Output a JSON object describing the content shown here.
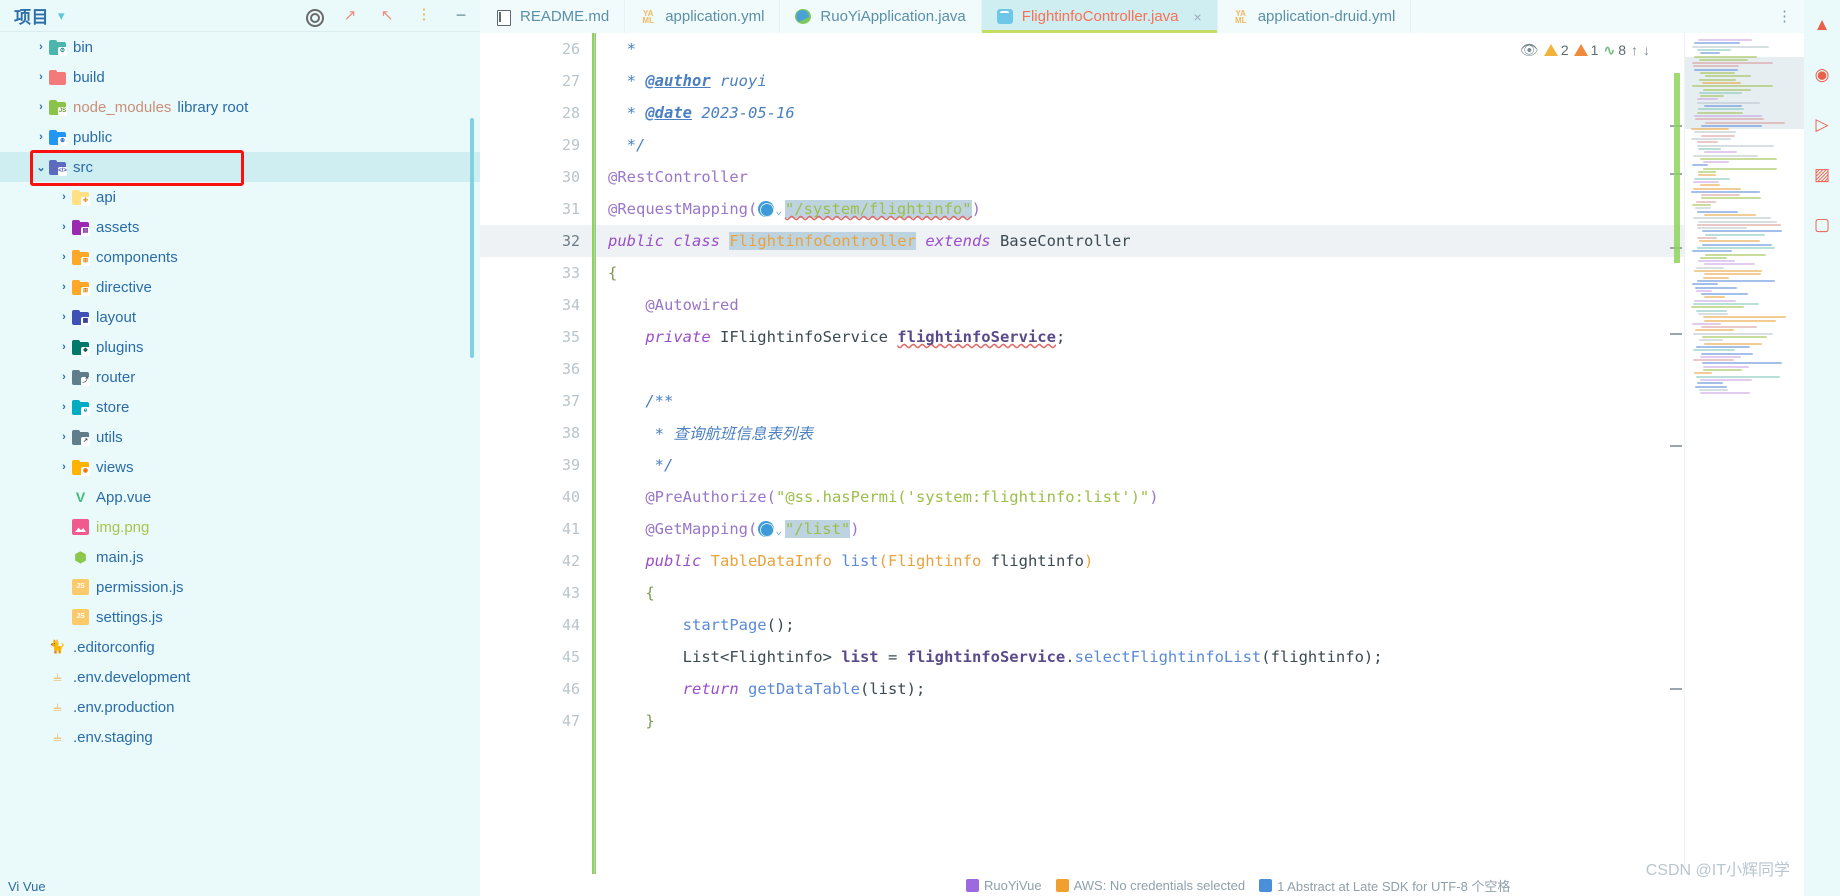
{
  "project_panel": {
    "title": "项目",
    "header_icons": [
      "target-icon",
      "expand-icon",
      "collapse-icon",
      "more-options-icon",
      "minimize-icon"
    ],
    "tree": [
      {
        "name": "bin",
        "type": "folder",
        "indent": 1,
        "arrow": "›",
        "color": "#4db6ac",
        "badge": "⚙",
        "badge_color": "#2a8f86",
        "selected": false
      },
      {
        "name": "build",
        "type": "folder",
        "indent": 1,
        "arrow": "›",
        "color": "#f27a7a",
        "badge": "",
        "badge_color": "#c44",
        "selected": false
      },
      {
        "name": "node_modules",
        "type": "folder",
        "indent": 1,
        "arrow": "›",
        "color": "#8bc34a",
        "badge": "JS",
        "badge_color": "#6a9a2a",
        "selected": false,
        "suffix": "library root"
      },
      {
        "name": "public",
        "type": "folder",
        "indent": 1,
        "arrow": "›",
        "color": "#2196f3",
        "badge": "⊕",
        "badge_color": "#1565c0",
        "selected": false
      },
      {
        "name": "src",
        "type": "folder",
        "indent": 1,
        "arrow": "⌄",
        "color": "#5c6bc0",
        "badge": "</>",
        "badge_color": "#3949ab",
        "selected": true
      },
      {
        "name": "api",
        "type": "folder",
        "indent": 2,
        "arrow": "›",
        "color": "#ffe082",
        "badge": "✤",
        "badge_color": "#e8933a",
        "selected": false
      },
      {
        "name": "assets",
        "type": "folder",
        "indent": 2,
        "arrow": "›",
        "color": "#9c27b0",
        "badge": "▤",
        "badge_color": "#7b1fa2",
        "selected": false
      },
      {
        "name": "components",
        "type": "folder",
        "indent": 2,
        "arrow": "›",
        "color": "#ffa726",
        "badge": "⊞",
        "badge_color": "#e07a00",
        "selected": false
      },
      {
        "name": "directive",
        "type": "folder",
        "indent": 2,
        "arrow": "›",
        "color": "#ffa726",
        "badge": "⊞",
        "badge_color": "#e07a00",
        "selected": false
      },
      {
        "name": "layout",
        "type": "folder",
        "indent": 2,
        "arrow": "›",
        "color": "#3f51b5",
        "badge": "▦",
        "badge_color": "#283593",
        "selected": false
      },
      {
        "name": "plugins",
        "type": "folder",
        "indent": 2,
        "arrow": "›",
        "color": "#00796b",
        "badge": "❖",
        "badge_color": "#004d40",
        "selected": false
      },
      {
        "name": "router",
        "type": "folder",
        "indent": 2,
        "arrow": "›",
        "color": "#607d8b",
        "badge": "⤴",
        "badge_color": "#37474f",
        "selected": false
      },
      {
        "name": "store",
        "type": "folder",
        "indent": 2,
        "arrow": "›",
        "color": "#00acc1",
        "badge": "e",
        "badge_color": "#00838f",
        "selected": false
      },
      {
        "name": "utils",
        "type": "folder",
        "indent": 2,
        "arrow": "›",
        "color": "#607d8b",
        "badge": "↗",
        "badge_color": "#37474f",
        "selected": false
      },
      {
        "name": "views",
        "type": "folder",
        "indent": 2,
        "arrow": "›",
        "color": "#ffb300",
        "badge": "◉",
        "badge_color": "#ef6c00",
        "selected": false
      },
      {
        "name": "App.vue",
        "type": "vue",
        "indent": 2,
        "arrow": "",
        "selected": false
      },
      {
        "name": "img.png",
        "type": "png",
        "indent": 2,
        "arrow": "",
        "selected": false,
        "dim": "green"
      },
      {
        "name": "main.js",
        "type": "node",
        "indent": 2,
        "arrow": "",
        "selected": false
      },
      {
        "name": "permission.js",
        "type": "js",
        "indent": 2,
        "arrow": "",
        "selected": false
      },
      {
        "name": "settings.js",
        "type": "js",
        "indent": 2,
        "arrow": "",
        "selected": false
      },
      {
        "name": ".editorconfig",
        "type": "cat",
        "indent": 1,
        "arrow": "",
        "selected": false
      },
      {
        "name": ".env.development",
        "type": "env",
        "indent": 1,
        "arrow": "",
        "selected": false
      },
      {
        "name": ".env.production",
        "type": "env",
        "indent": 1,
        "arrow": "",
        "selected": false
      },
      {
        "name": ".env.staging",
        "type": "env",
        "indent": 1,
        "arrow": "",
        "selected": false
      }
    ]
  },
  "tabs": [
    {
      "label": "README.md",
      "icon": "markdown-icon",
      "active": false,
      "closable": false
    },
    {
      "label": "application.yml",
      "icon": "yaml-icon",
      "active": false,
      "closable": false
    },
    {
      "label": "RuoYiApplication.java",
      "icon": "spring-icon",
      "active": false,
      "closable": false
    },
    {
      "label": "FlightinfoController.java",
      "icon": "java-class-icon",
      "active": true,
      "closable": true
    },
    {
      "label": "application-druid.yml",
      "icon": "yaml-icon",
      "active": false,
      "closable": false
    }
  ],
  "tab_close_label": "×",
  "inspection": {
    "eye_icon": "inspection-eye-icon",
    "warnings": "2",
    "weak_warnings": "1",
    "typos": "8",
    "prev_icon": "↑",
    "next_icon": "↓"
  },
  "editor": {
    "active_file": "FlightinfoController.java",
    "current_line": 32,
    "lines": [
      {
        "n": 26,
        "marker": "",
        "tokens": [
          {
            "t": "*",
            "c": "cmt",
            "indent": 0
          }
        ]
      },
      {
        "n": 27,
        "marker": "",
        "tokens": [
          {
            "t": "* @author ruoyi",
            "c": "cmt",
            "indent": 0
          }
        ]
      },
      {
        "n": 28,
        "marker": "",
        "tokens": [
          {
            "t": "* @date 2023-05-16",
            "c": "cmt",
            "indent": 0
          }
        ]
      },
      {
        "n": 29,
        "marker": "",
        "tokens": [
          {
            "t": "*/",
            "c": "cmt",
            "indent": 0
          }
        ]
      },
      {
        "n": 30,
        "marker": "",
        "tokens": [
          {
            "t": "@RestController",
            "c": "ann",
            "indent": 0
          }
        ]
      },
      {
        "n": 31,
        "marker": "",
        "tokens": [
          {
            "t": "@RequestMapping(",
            "c": "ann",
            "indent": 0
          }
        ]
      },
      {
        "n": 32,
        "marker": "bookmark",
        "tokens": [
          {
            "t": "public class FlightinfoController extends BaseController",
            "c": "mix",
            "indent": 0
          }
        ]
      },
      {
        "n": 33,
        "marker": "",
        "tokens": [
          {
            "t": "{",
            "c": "brc",
            "indent": 0
          }
        ]
      },
      {
        "n": 34,
        "marker": "",
        "tokens": [
          {
            "t": "@Autowired",
            "c": "ann",
            "indent": 1
          }
        ]
      },
      {
        "n": 35,
        "marker": "bean",
        "tokens": [
          {
            "t": "private IFlightinfoService flightinfoService;",
            "c": "mix",
            "indent": 1
          }
        ]
      },
      {
        "n": 36,
        "marker": "",
        "tokens": [
          {
            "t": "",
            "c": "pln",
            "indent": 0
          }
        ]
      },
      {
        "n": 37,
        "marker": "",
        "tokens": [
          {
            "t": "/**",
            "c": "cmt",
            "indent": 1
          }
        ]
      },
      {
        "n": 38,
        "marker": "",
        "tokens": [
          {
            "t": "* 查询航班信息表列表",
            "c": "cmt",
            "indent": 1
          }
        ]
      },
      {
        "n": 39,
        "marker": "",
        "tokens": [
          {
            "t": "*/",
            "c": "cmt",
            "indent": 1
          }
        ]
      },
      {
        "n": 40,
        "marker": "",
        "tokens": [
          {
            "t": "@PreAuthorize(\"@ss.hasPermi('system:flightinfo:list')\")",
            "c": "mix",
            "indent": 1
          }
        ]
      },
      {
        "n": 41,
        "marker": "",
        "tokens": [
          {
            "t": "@GetMapping(",
            "c": "ann",
            "indent": 1
          }
        ]
      },
      {
        "n": 42,
        "marker": "endpoint",
        "tokens": [
          {
            "t": "public TableDataInfo list(Flightinfo flightinfo)",
            "c": "mix",
            "indent": 1
          }
        ]
      },
      {
        "n": 43,
        "marker": "",
        "tokens": [
          {
            "t": "{",
            "c": "brc",
            "indent": 1
          }
        ]
      },
      {
        "n": 44,
        "marker": "",
        "tokens": [
          {
            "t": "startPage();",
            "c": "mix",
            "indent": 2
          }
        ]
      },
      {
        "n": 45,
        "marker": "",
        "tokens": [
          {
            "t": "List<Flightinfo> list = flightinfoService.selectFlightinfoList(flightinfo);",
            "c": "mix",
            "indent": 2
          }
        ]
      },
      {
        "n": 46,
        "marker": "",
        "tokens": [
          {
            "t": "return getDataTable(list);",
            "c": "mix",
            "indent": 2
          }
        ]
      },
      {
        "n": 47,
        "marker": "",
        "tokens": [
          {
            "t": "}",
            "c": "brc",
            "indent": 1
          }
        ]
      }
    ],
    "code_text": {
      "l26": "*",
      "l27_star": "*",
      "l27_tag": "@author",
      "l27_val": "ruoyi",
      "l28_star": "*",
      "l28_tag": "@date",
      "l28_val": "2023-05-16",
      "l29": "*/",
      "l30": "@RestController",
      "l31_ann": "@RequestMapping(",
      "l31_str": "\"/system/flightinfo\"",
      "l31_end": ")",
      "l32_kw1": "public",
      "l32_kw2": "class",
      "l32_name": "FlightinfoController",
      "l32_kw3": "extends",
      "l32_base": "BaseController",
      "l33": "{",
      "l34": "@Autowired",
      "l35_kw": "private",
      "l35_type": "IFlightinfoService",
      "l35_field": "flightinfoService",
      "l35_semi": ";",
      "l37": "/**",
      "l38_star": "*",
      "l38_text": "查询航班信息表列表",
      "l39": "*/",
      "l40_ann": "@PreAuthorize(",
      "l40_str": "\"@ss.hasPermi('system:flightinfo:list')\"",
      "l40_end": ")",
      "l41_ann": "@GetMapping(",
      "l41_str": "\"/list\"",
      "l41_end": ")",
      "l42_kw": "public",
      "l42_ret": "TableDataInfo",
      "l42_mth": "list",
      "l42_open": "(",
      "l42_ptype": "Flightinfo",
      "l42_pname": "flightinfo",
      "l42_close": ")",
      "l43": "{",
      "l44_mth": "startPage",
      "l44_rest": "();",
      "l45_type": "List<Flightinfo>",
      "l45_var": "list",
      "l45_eq": "=",
      "l45_obj": "flightinfoService",
      "l45_dot": ".",
      "l45_call": "selectFlightinfoList",
      "l45_arg": "(flightinfo);",
      "l46_kw": "return",
      "l46_call": "getDataTable",
      "l46_arg": "(list);",
      "l47": "}"
    }
  },
  "watermark": "CSDN @IT小辉同学",
  "bottom_bar": {
    "items": [
      {
        "label": "RuoYiVue",
        "color": "#9c6ade"
      },
      {
        "label": "AWS: No credentials selected",
        "color": "#f0a030"
      },
      {
        "label": "1 Abstract at Late SDK for UTF-8 个空格",
        "color": "#4a90d9"
      }
    ]
  },
  "bottom_left_label": "Vi Vue",
  "colors": {
    "panel_bg": "#eafafa",
    "selection": "#cfeef2",
    "active_tab_underline": "#c3dd63",
    "active_tab_text": "#fb7055",
    "outline_red": "#fb0f0f",
    "string_green": "#9bbf4a",
    "annotation_purple": "#9876c9",
    "keyword_purple": "#9b4dcc",
    "class_orange": "#e8a33d",
    "comment_blue": "#4a7fc1"
  }
}
